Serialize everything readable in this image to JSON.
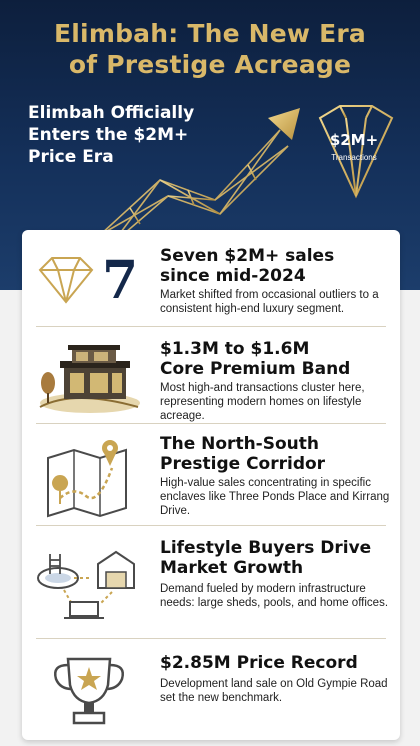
{
  "header": {
    "title_line1": "Elimbah: The New Era",
    "title_line2": "of Prestige Acreage",
    "subtitle_line1": "Elimbah Officially",
    "subtitle_line2": "Enters the $2M+",
    "subtitle_line3": "Price Era",
    "badge_value": "$2M+",
    "badge_label": "Transactions"
  },
  "items": [
    {
      "icon": "diamond-icon",
      "number": "7",
      "title_line1": "Seven $2M+ sales",
      "title_line2": "since mid-2024",
      "desc": "Market shifted from occasional outliers to a consistent high-end luxury segment."
    },
    {
      "icon": "modern-house-icon",
      "title_line1": "$1.3M to $1.6M",
      "title_line2": "Core Premium Band",
      "desc": "Most high-and transactions cluster here, representing modern homes on lifestyle acreage."
    },
    {
      "icon": "map-pin-icon",
      "title_line1": "The North-South",
      "title_line2": "Prestige Corridor",
      "desc": "High-value sales concentrating in specific enclaves like Three Ponds Place and Kirrang Drive."
    },
    {
      "icon": "lifestyle-amenities-icon",
      "title_line1": "Lifestyle Buyers Drive",
      "title_line2": "Market Growth",
      "desc": "Demand fueled by modern infrastructure needs: large sheds, pools, and home offices."
    },
    {
      "icon": "trophy-icon",
      "title_line1": "$2.85M Price Record",
      "title_line2": "",
      "desc": "Development land sale on Old Gympie Road set the new benchmark."
    }
  ],
  "colors": {
    "navy": "#0d1f3d",
    "gold": "#d9b869",
    "card": "#ffffff"
  }
}
